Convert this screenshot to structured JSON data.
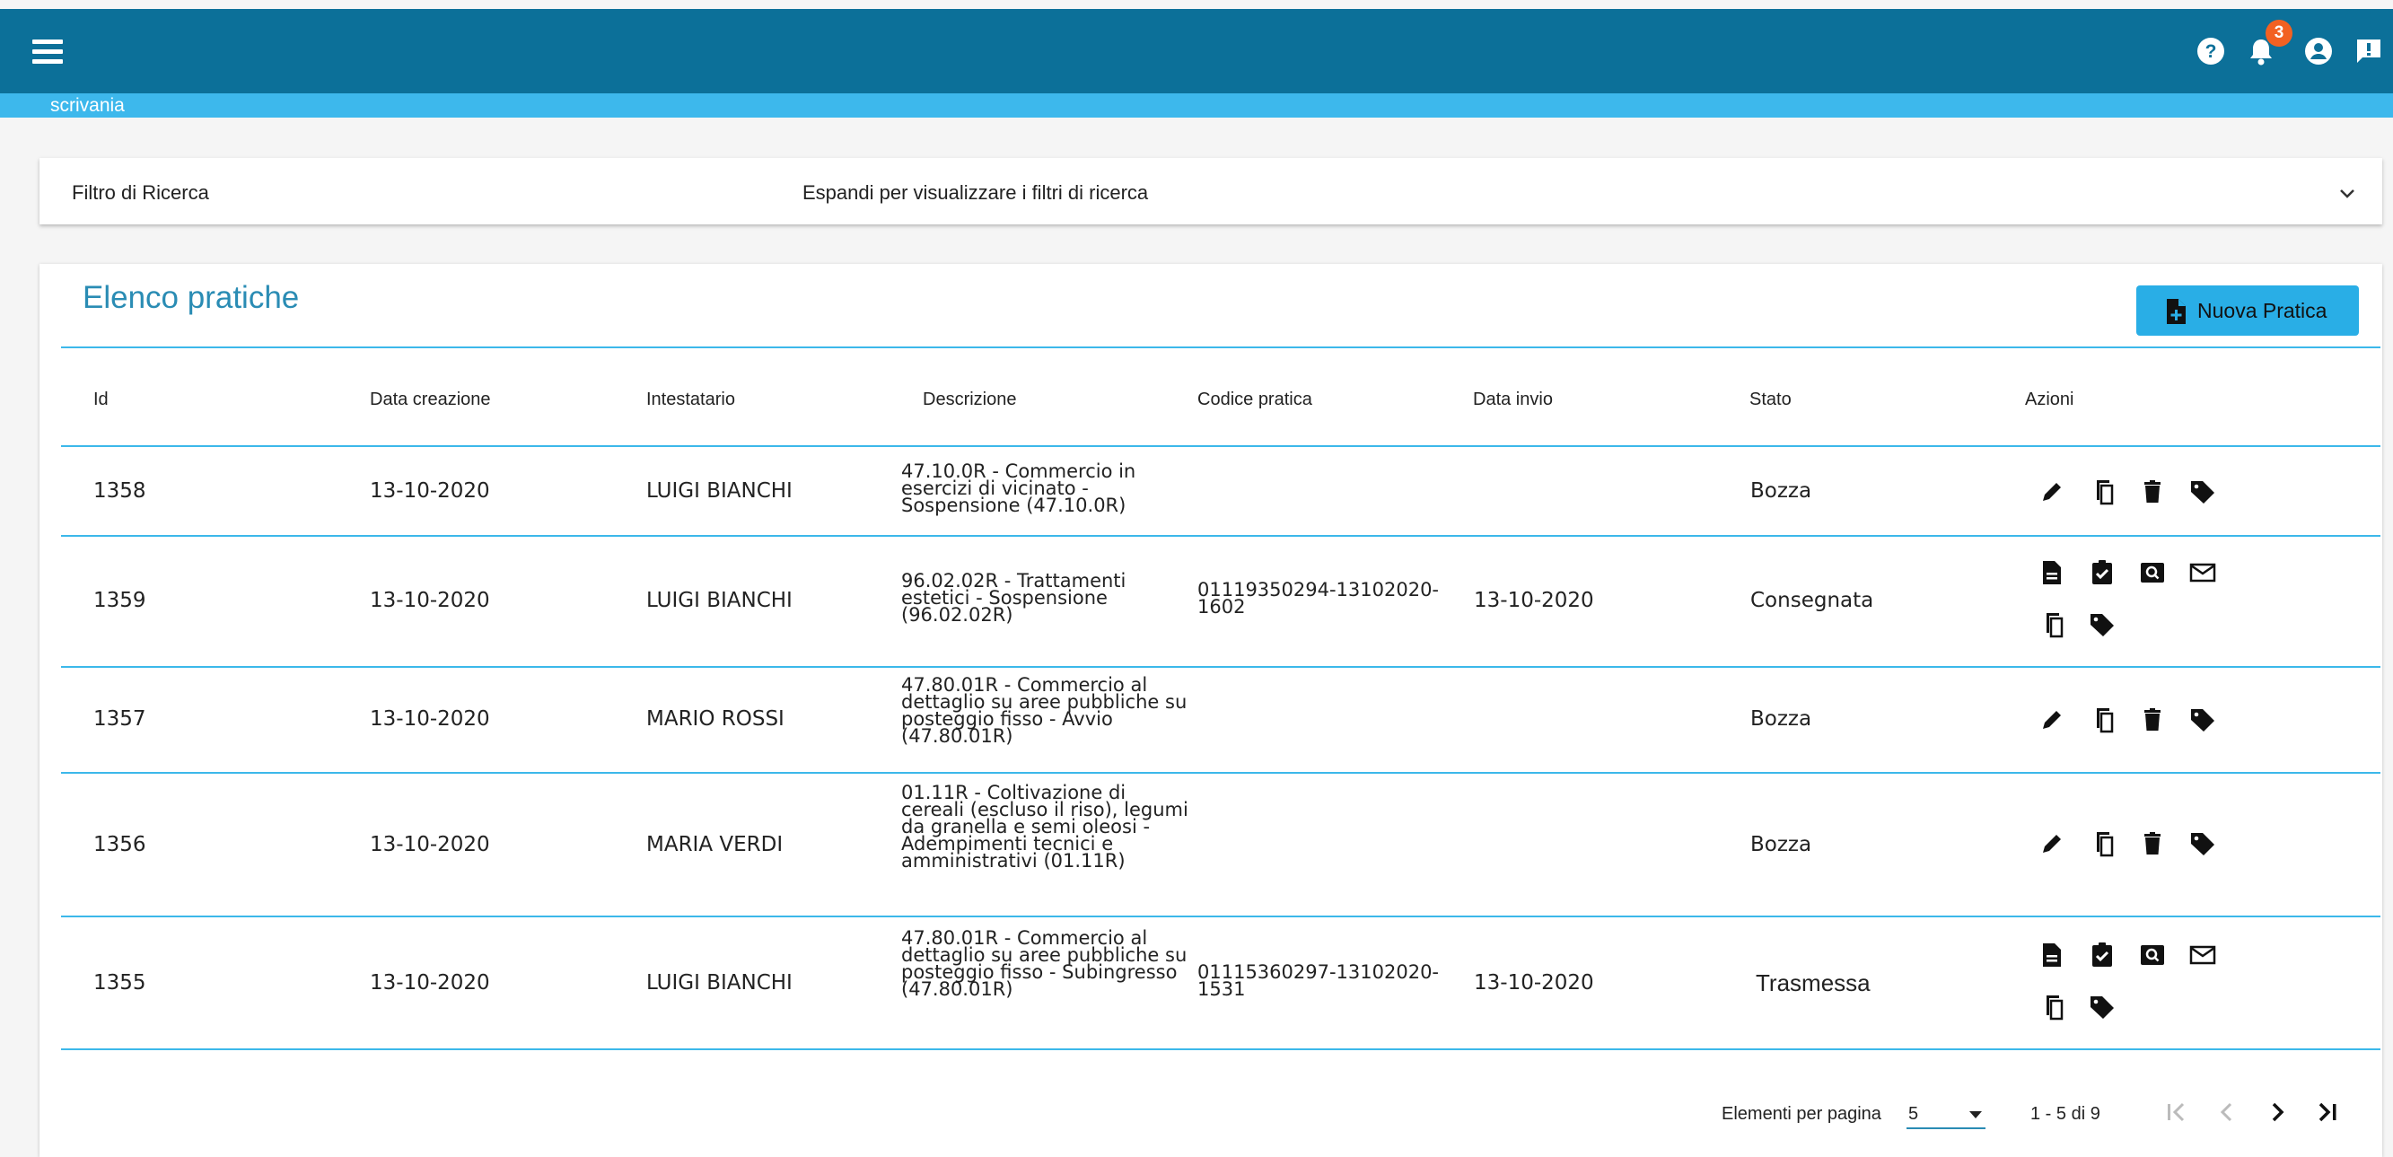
{
  "header": {
    "notification_count": "3",
    "section_label": "scrivania",
    "colors": {
      "topbar": "#0c7099",
      "subbar": "#3db8ec",
      "accent": "#29aee6",
      "badge": "#f26122"
    },
    "icons": [
      "menu-icon",
      "help-icon",
      "bell-icon",
      "account-icon",
      "feedback-icon"
    ]
  },
  "filter": {
    "title": "Filtro di Ricerca",
    "description": "Espandi per visualizzare i filtri di ricerca"
  },
  "list": {
    "title": "Elenco pratiche",
    "new_button_label": "Nuova Pratica",
    "columns": [
      "Id",
      "Data creazione",
      "Intestatario",
      "Descrizione",
      "Codice pratica",
      "Data invio",
      "Stato",
      "Azioni"
    ],
    "rows": [
      {
        "id": "1358",
        "data_creazione": "13-10-2020",
        "intestatario": "LUIGI BIANCHI",
        "descrizione": "47.10.0R - Commercio in esercizi di vicinato - Sospensione (47.10.0R)",
        "codice": "",
        "data_invio": "",
        "stato": "Bozza",
        "actions": [
          "edit-icon",
          "copy-icon",
          "delete-icon",
          "tag-icon"
        ]
      },
      {
        "id": "1359",
        "data_creazione": "13-10-2020",
        "intestatario": "LUIGI BIANCHI",
        "descrizione": "96.02.02R - Trattamenti estetici - Sospensione (96.02.02R)",
        "codice": "01119350294-13102020-1602",
        "data_invio": "13-10-2020",
        "stato": "Consegnata",
        "actions": [
          "document-icon",
          "clipboard-check-icon",
          "preview-icon",
          "mail-icon",
          "copy-icon",
          "tag-icon"
        ]
      },
      {
        "id": "1357",
        "data_creazione": "13-10-2020",
        "intestatario": "MARIO ROSSI",
        "descrizione": "47.80.01R - Commercio al dettaglio su aree pubbliche su posteggio fisso - Avvio (47.80.01R)",
        "codice": "",
        "data_invio": "",
        "stato": "Bozza",
        "actions": [
          "edit-icon",
          "copy-icon",
          "delete-icon",
          "tag-icon"
        ]
      },
      {
        "id": "1356",
        "data_creazione": "13-10-2020",
        "intestatario": "MARIA VERDI",
        "descrizione": "01.11R - Coltivazione di cereali (escluso il riso), legumi da granella e semi oleosi - Adempimenti tecnici e amministrativi (01.11R)",
        "codice": "",
        "data_invio": "",
        "stato": "Bozza",
        "actions": [
          "edit-icon",
          "copy-icon",
          "delete-icon",
          "tag-icon"
        ]
      },
      {
        "id": "1355",
        "data_creazione": "13-10-2020",
        "intestatario": "LUIGI BIANCHI",
        "descrizione": "47.80.01R - Commercio al dettaglio su aree pubbliche su posteggio fisso - Subingresso (47.80.01R)",
        "codice": "01115360297-13102020-1531",
        "data_invio": "13-10-2020",
        "stato": "Trasmessa",
        "actions": [
          "document-icon",
          "clipboard-check-icon",
          "preview-icon",
          "mail-icon",
          "copy-icon",
          "tag-icon"
        ]
      }
    ]
  },
  "pagination": {
    "per_page_label": "Elementi per pagina",
    "per_page_value": "5",
    "range_label": "1 - 5 di 9"
  }
}
